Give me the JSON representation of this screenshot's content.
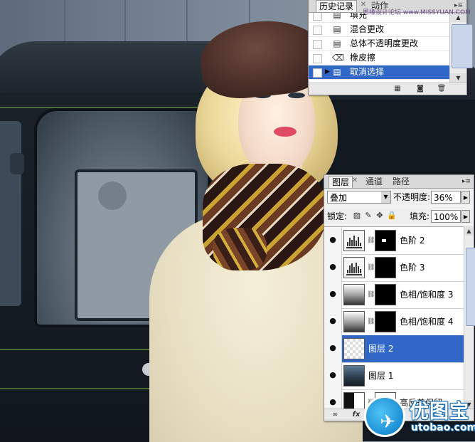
{
  "history_panel": {
    "tabs": [
      {
        "label": "历史记录",
        "active": true
      },
      {
        "label": "动作",
        "active": false
      }
    ],
    "items": [
      {
        "label": "填充",
        "icon": "document-icon",
        "selected": false
      },
      {
        "label": "混合更改",
        "icon": "document-icon",
        "selected": false
      },
      {
        "label": "总体不透明度更改",
        "icon": "document-icon",
        "selected": false
      },
      {
        "label": "橡皮擦",
        "icon": "eraser-icon",
        "selected": false
      },
      {
        "label": "取消选择",
        "icon": "document-icon",
        "selected": true
      }
    ],
    "watermark": "思缘设计论坛 www.MISSYUAN.COM"
  },
  "layers_panel": {
    "tabs": [
      {
        "label": "图层",
        "active": true
      },
      {
        "label": "通道",
        "active": false
      },
      {
        "label": "路径",
        "active": false
      }
    ],
    "blend_mode": "叠加",
    "opacity_label": "不透明度:",
    "opacity_value": "36%",
    "lock_label": "锁定:",
    "fill_label": "填充:",
    "fill_value": "100%",
    "layers": [
      {
        "name": "色阶 2",
        "thumb": "levels",
        "mask": "black-dot",
        "selected": false
      },
      {
        "name": "色阶 3",
        "thumb": "levels",
        "mask": "black",
        "selected": false
      },
      {
        "name": "色相/饱和度 3",
        "thumb": "hue",
        "mask": "black",
        "selected": false
      },
      {
        "name": "色相/饱和度 4",
        "thumb": "hue",
        "mask": "black",
        "selected": false
      },
      {
        "name": "图层 2",
        "thumb": "checker",
        "mask": "none",
        "selected": true
      },
      {
        "name": "图层 1",
        "thumb": "photo",
        "mask": "none",
        "selected": false
      },
      {
        "name": "高反差保留",
        "thumb": "split",
        "mask": "white",
        "selected": false
      }
    ]
  },
  "logo": {
    "text": "优图宝",
    "url": "utobao.com"
  },
  "colors": {
    "selection": "#3168c8",
    "panel_bg": "#f3f3f3",
    "logo_blue": "#1d8fd6"
  }
}
